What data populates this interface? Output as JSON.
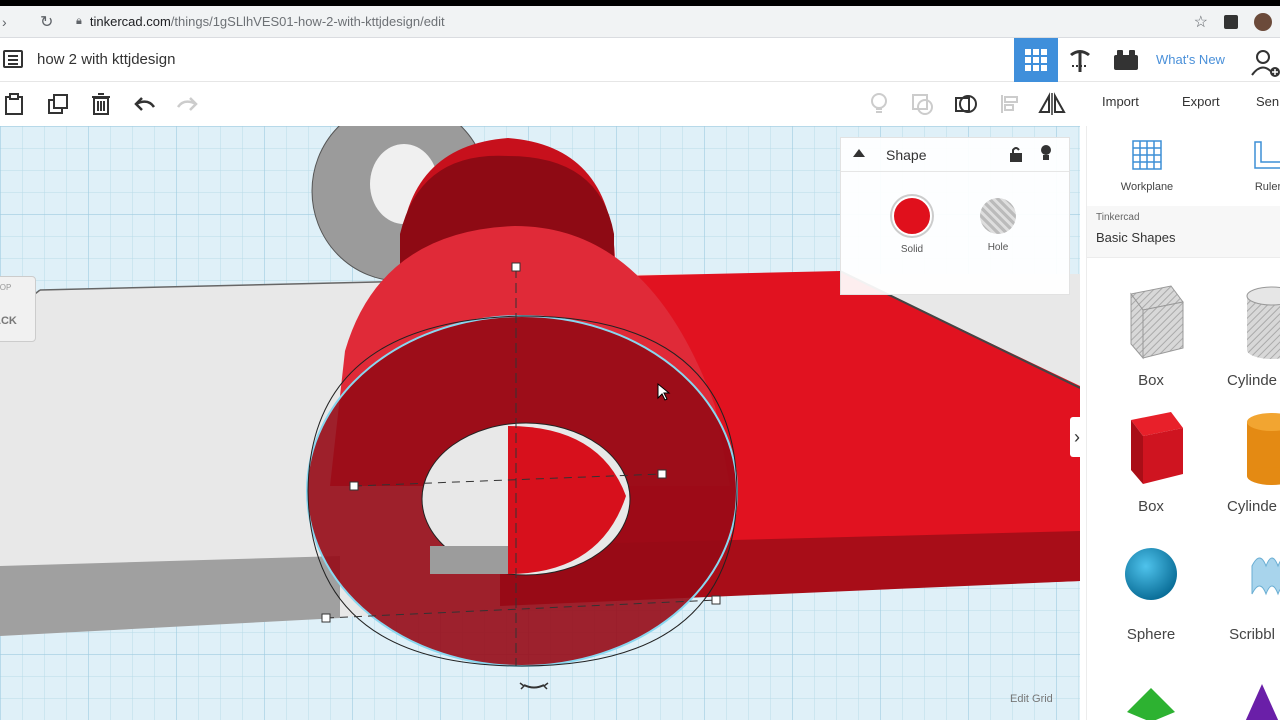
{
  "browser": {
    "url_host": "tinkercad.com",
    "url_path": "/things/1gSLlhVES01-how-2-with-kttjdesign/edit"
  },
  "app": {
    "design_title": "how 2 with kttjdesign",
    "whats_new": "What's New"
  },
  "toolbar": {
    "import": "Import",
    "export": "Export",
    "send": "Sen"
  },
  "viewcube": {
    "face_top": "TOP",
    "face_label": "ACK"
  },
  "shape_panel": {
    "title": "Shape",
    "solid_label": "Solid",
    "hole_label": "Hole",
    "solid_color": "#e0101c"
  },
  "viewport": {
    "edit_grid": "Edit Grid"
  },
  "sidebar": {
    "workplane": "Workplane",
    "ruler": "Ruler",
    "category_small": "Tinkercad",
    "category": "Basic Shapes",
    "items": [
      {
        "label": "Box",
        "icon": "box-hole-icon"
      },
      {
        "label": "Cylinde",
        "icon": "cylinder-hole-icon"
      },
      {
        "label": "Box",
        "icon": "box-red-icon"
      },
      {
        "label": "Cylinde",
        "icon": "cylinder-orange-icon"
      },
      {
        "label": "Sphere",
        "icon": "sphere-blue-icon"
      },
      {
        "label": "Scribbl",
        "icon": "scribble-icon"
      }
    ]
  }
}
